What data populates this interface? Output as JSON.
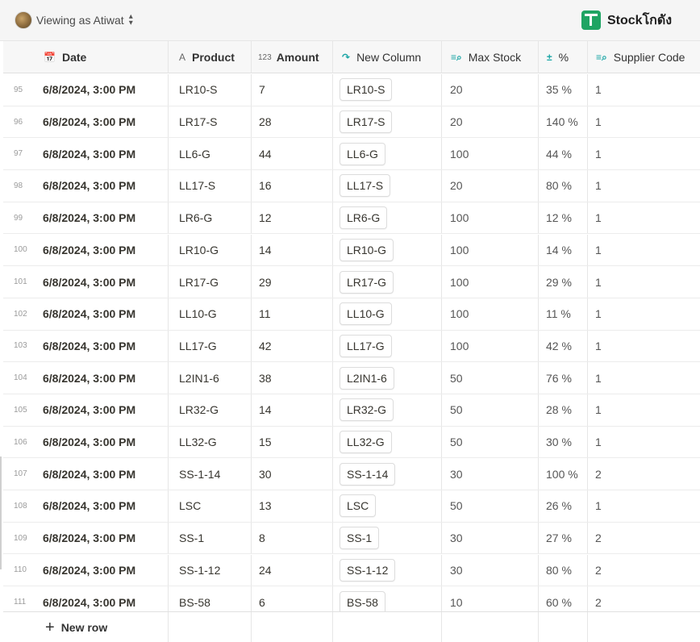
{
  "header": {
    "viewing_as": "Viewing as Atiwat",
    "brand": "Stockโกดัง"
  },
  "columns": [
    {
      "label": "Date",
      "icon": "calendar-icon"
    },
    {
      "label": "Product",
      "icon": "text-type-icon"
    },
    {
      "label": "Amount",
      "icon": "number-type-icon"
    },
    {
      "label": "New Column",
      "icon": "relation-arrow-icon"
    },
    {
      "label": "Max Stock",
      "icon": "lookup-icon"
    },
    {
      "label": "%",
      "icon": "formula-icon"
    },
    {
      "label": "Supplier Code",
      "icon": "lookup-icon"
    }
  ],
  "rows": [
    {
      "n": "95",
      "date": "6/8/2024, 3:00 PM",
      "product": "LR10-S",
      "amount": "7",
      "newcol": "LR10-S",
      "max": "20",
      "pct": "35 %",
      "supplier": "1"
    },
    {
      "n": "96",
      "date": "6/8/2024, 3:00 PM",
      "product": "LR17-S",
      "amount": "28",
      "newcol": "LR17-S",
      "max": "20",
      "pct": "140 %",
      "supplier": "1"
    },
    {
      "n": "97",
      "date": "6/8/2024, 3:00 PM",
      "product": "LL6-G",
      "amount": "44",
      "newcol": "LL6-G",
      "max": "100",
      "pct": "44 %",
      "supplier": "1"
    },
    {
      "n": "98",
      "date": "6/8/2024, 3:00 PM",
      "product": "LL17-S",
      "amount": "16",
      "newcol": "LL17-S",
      "max": "20",
      "pct": "80 %",
      "supplier": "1"
    },
    {
      "n": "99",
      "date": "6/8/2024, 3:00 PM",
      "product": "LR6-G",
      "amount": "12",
      "newcol": "LR6-G",
      "max": "100",
      "pct": "12 %",
      "supplier": "1"
    },
    {
      "n": "100",
      "date": "6/8/2024, 3:00 PM",
      "product": "LR10-G",
      "amount": "14",
      "newcol": "LR10-G",
      "max": "100",
      "pct": "14 %",
      "supplier": "1"
    },
    {
      "n": "101",
      "date": "6/8/2024, 3:00 PM",
      "product": "LR17-G",
      "amount": "29",
      "newcol": "LR17-G",
      "max": "100",
      "pct": "29 %",
      "supplier": "1"
    },
    {
      "n": "102",
      "date": "6/8/2024, 3:00 PM",
      "product": "LL10-G",
      "amount": "11",
      "newcol": "LL10-G",
      "max": "100",
      "pct": "11 %",
      "supplier": "1"
    },
    {
      "n": "103",
      "date": "6/8/2024, 3:00 PM",
      "product": "LL17-G",
      "amount": "42",
      "newcol": "LL17-G",
      "max": "100",
      "pct": "42 %",
      "supplier": "1"
    },
    {
      "n": "104",
      "date": "6/8/2024, 3:00 PM",
      "product": "L2IN1-6",
      "amount": "38",
      "newcol": "L2IN1-6",
      "max": "50",
      "pct": "76 %",
      "supplier": "1"
    },
    {
      "n": "105",
      "date": "6/8/2024, 3:00 PM",
      "product": "LR32-G",
      "amount": "14",
      "newcol": "LR32-G",
      "max": "50",
      "pct": "28 %",
      "supplier": "1"
    },
    {
      "n": "106",
      "date": "6/8/2024, 3:00 PM",
      "product": "LL32-G",
      "amount": "15",
      "newcol": "LL32-G",
      "max": "50",
      "pct": "30 %",
      "supplier": "1"
    },
    {
      "n": "107",
      "date": "6/8/2024, 3:00 PM",
      "product": "SS-1-14",
      "amount": "30",
      "newcol": "SS-1-14",
      "max": "30",
      "pct": "100 %",
      "supplier": "2"
    },
    {
      "n": "108",
      "date": "6/8/2024, 3:00 PM",
      "product": "LSC",
      "amount": "13",
      "newcol": "LSC",
      "max": "50",
      "pct": "26 %",
      "supplier": "1"
    },
    {
      "n": "109",
      "date": "6/8/2024, 3:00 PM",
      "product": "SS-1",
      "amount": "8",
      "newcol": "SS-1",
      "max": "30",
      "pct": "27 %",
      "supplier": "2"
    },
    {
      "n": "110",
      "date": "6/8/2024, 3:00 PM",
      "product": "SS-1-12",
      "amount": "24",
      "newcol": "SS-1-12",
      "max": "30",
      "pct": "80 %",
      "supplier": "2"
    },
    {
      "n": "111",
      "date": "6/8/2024, 3:00 PM",
      "product": "BS-58",
      "amount": "6",
      "newcol": "BS-58",
      "max": "10",
      "pct": "60 %",
      "supplier": "2"
    }
  ],
  "footer": {
    "new_row": "New row"
  },
  "colors": {
    "brand": "#1fa463",
    "teal_icon": "#1aa5a5"
  }
}
